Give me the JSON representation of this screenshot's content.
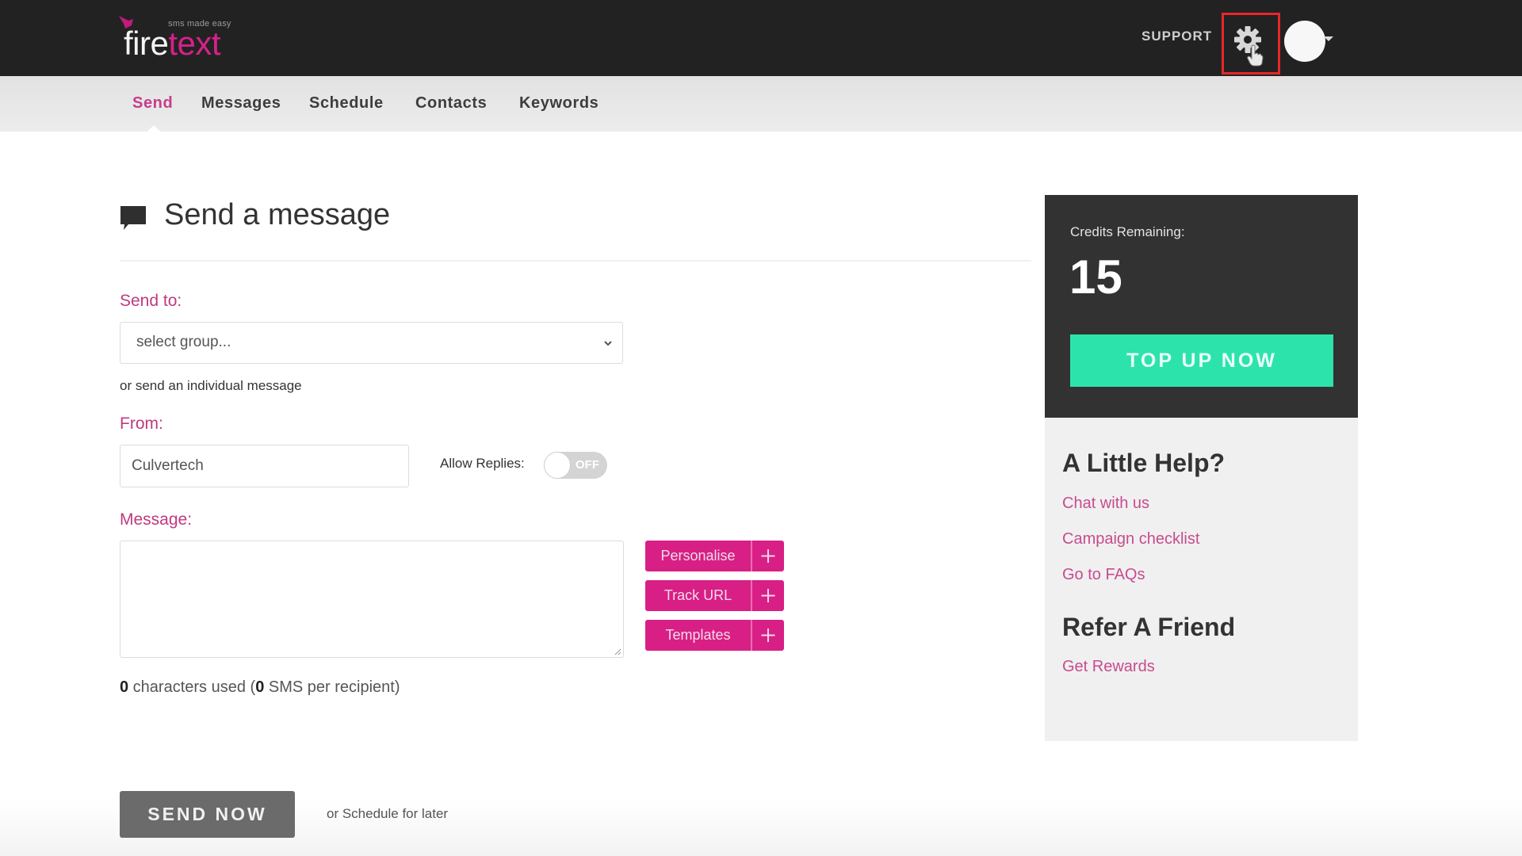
{
  "header": {
    "logo": {
      "word_primary": "fire",
      "word_accent": "text",
      "tagline": "sms made easy"
    },
    "support_label": "SUPPORT",
    "settings_icon": "gear-icon",
    "avatar_icon": "user-avatar"
  },
  "nav": {
    "items": [
      {
        "label": "Send",
        "active": true
      },
      {
        "label": "Messages",
        "active": false
      },
      {
        "label": "Schedule",
        "active": false
      },
      {
        "label": "Contacts",
        "active": false
      },
      {
        "label": "Keywords",
        "active": false
      }
    ]
  },
  "main": {
    "title": "Send a message",
    "send_to_label": "Send to:",
    "group_select": {
      "value": "select group...",
      "options_visible": [
        "select group..."
      ]
    },
    "individual_link": "or send an individual message",
    "from_label": "From:",
    "from_value": "Culvertech",
    "allow_replies_label": "Allow Replies:",
    "allow_replies_state": "OFF",
    "message_label": "Message:",
    "message_value": "",
    "action_buttons": [
      {
        "label": "Personalise",
        "icon": "plus-icon"
      },
      {
        "label": "Track URL",
        "icon": "plus-icon"
      },
      {
        "label": "Templates",
        "icon": "plus-icon"
      }
    ],
    "counter": {
      "chars": "0",
      "chars_text": " characters used (",
      "sms": "0",
      "sms_text": " SMS per recipient)"
    },
    "send_now_label": "SEND NOW",
    "schedule_later_label": "or Schedule for later"
  },
  "sidebar": {
    "credits_label": "Credits Remaining:",
    "credits_value": "15",
    "top_up_label": "TOP UP NOW",
    "help_title": "A Little Help?",
    "help_links": [
      "Chat with us",
      "Campaign checklist",
      "Go to FAQs"
    ],
    "refer_title": "Refer A Friend",
    "refer_link": "Get Rewards"
  },
  "colors": {
    "brand_pink": "#d81f86",
    "label_pink": "#c0397f",
    "top_up_green": "#2de3ac",
    "header_bg": "#232222",
    "highlight_red": "#e8262b"
  }
}
